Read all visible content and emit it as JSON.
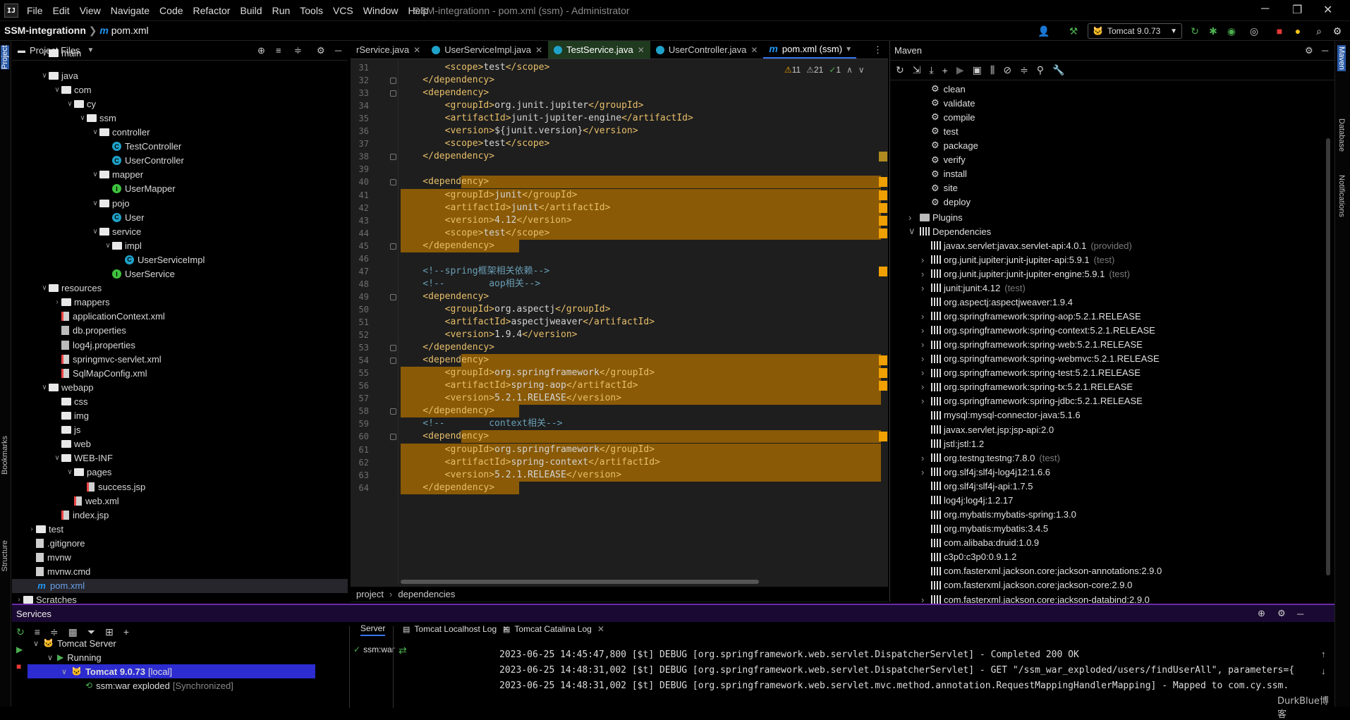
{
  "title_bar": {
    "logo": "IJ",
    "menus": [
      "File",
      "Edit",
      "View",
      "Navigate",
      "Code",
      "Refactor",
      "Build",
      "Run",
      "Tools",
      "VCS",
      "Window",
      "Help"
    ],
    "title": "SSM-integrationn - pom.xml (ssm) - Administrator"
  },
  "nav": {
    "project": "SSM-integrationn",
    "file": "pom.xml",
    "run_config": "Tomcat 9.0.73"
  },
  "left_strip": {
    "project": "Project",
    "bookmarks": "Bookmarks",
    "structure": "Structure"
  },
  "project_panel": {
    "title": "Project Files",
    "tree": [
      {
        "label": "main",
        "kind": "folder"
      },
      {
        "label": "java",
        "kind": "folder"
      },
      {
        "label": "com",
        "kind": "folder"
      },
      {
        "label": "cy",
        "kind": "folder"
      },
      {
        "label": "ssm",
        "kind": "folder"
      },
      {
        "label": "controller",
        "kind": "folder"
      },
      {
        "label": "TestController",
        "kind": "class"
      },
      {
        "label": "UserController",
        "kind": "class"
      },
      {
        "label": "mapper",
        "kind": "folder"
      },
      {
        "label": "UserMapper",
        "kind": "interface"
      },
      {
        "label": "pojo",
        "kind": "folder"
      },
      {
        "label": "User",
        "kind": "class"
      },
      {
        "label": "service",
        "kind": "folder"
      },
      {
        "label": "impl",
        "kind": "folder"
      },
      {
        "label": "UserServiceImpl",
        "kind": "class"
      },
      {
        "label": "UserService",
        "kind": "interface"
      },
      {
        "label": "resources",
        "kind": "folder"
      },
      {
        "label": "mappers",
        "kind": "folder"
      },
      {
        "label": "applicationContext.xml",
        "kind": "xml"
      },
      {
        "label": "db.properties",
        "kind": "prop"
      },
      {
        "label": "log4j.properties",
        "kind": "prop"
      },
      {
        "label": "springmvc-servlet.xml",
        "kind": "xml"
      },
      {
        "label": "SqlMapConfig.xml",
        "kind": "xml"
      },
      {
        "label": "webapp",
        "kind": "folder"
      },
      {
        "label": "css",
        "kind": "folder"
      },
      {
        "label": "img",
        "kind": "folder"
      },
      {
        "label": "js",
        "kind": "folder"
      },
      {
        "label": "web",
        "kind": "folder"
      },
      {
        "label": "WEB-INF",
        "kind": "folder"
      },
      {
        "label": "pages",
        "kind": "folder"
      },
      {
        "label": "success.jsp",
        "kind": "jsp"
      },
      {
        "label": "web.xml",
        "kind": "xml"
      },
      {
        "label": "index.jsp",
        "kind": "jsp"
      },
      {
        "label": "test",
        "kind": "folder"
      },
      {
        "label": ".gitignore",
        "kind": "file"
      },
      {
        "label": "mvnw",
        "kind": "file"
      },
      {
        "label": "mvnw.cmd",
        "kind": "file"
      },
      {
        "label": "pom.xml",
        "kind": "pom"
      },
      {
        "label": "Scratches",
        "kind": "folder"
      }
    ]
  },
  "editor": {
    "tabs": [
      {
        "label": "rService.java",
        "kind": "class"
      },
      {
        "label": "UserServiceImpl.java",
        "kind": "class"
      },
      {
        "label": "TestService.java",
        "kind": "class"
      },
      {
        "label": "UserController.java",
        "kind": "class"
      },
      {
        "label": "pom.xml (ssm)",
        "kind": "pom"
      }
    ],
    "inspections": {
      "warnings": "11",
      "weak": "21",
      "ok": "1"
    },
    "lines": [
      {
        "n": "31",
        "text": "        <scope>test</scope>"
      },
      {
        "n": "32",
        "text": "    </dependency>"
      },
      {
        "n": "33",
        "text": "    <dependency>"
      },
      {
        "n": "34",
        "text": "        <groupId>org.junit.jupiter</groupId>"
      },
      {
        "n": "35",
        "text": "        <artifactId>junit-jupiter-engine</artifactId>"
      },
      {
        "n": "36",
        "text": "        <version>${junit.version}</version>"
      },
      {
        "n": "37",
        "text": "        <scope>test</scope>"
      },
      {
        "n": "38",
        "text": "    </dependency>"
      },
      {
        "n": "39",
        "text": ""
      },
      {
        "n": "40",
        "text": "    <dependency>"
      },
      {
        "n": "41",
        "text": "        <groupId>junit</groupId>"
      },
      {
        "n": "42",
        "text": "        <artifactId>junit</artifactId>"
      },
      {
        "n": "43",
        "text": "        <version>4.12</version>"
      },
      {
        "n": "44",
        "text": "        <scope>test</scope>"
      },
      {
        "n": "45",
        "text": "    </dependency>"
      },
      {
        "n": "46",
        "text": ""
      },
      {
        "n": "47",
        "text": "    <!--spring框架相关依赖-->"
      },
      {
        "n": "48",
        "text": "    <!--        aop相关-->"
      },
      {
        "n": "49",
        "text": "    <dependency>"
      },
      {
        "n": "50",
        "text": "        <groupId>org.aspectj</groupId>"
      },
      {
        "n": "51",
        "text": "        <artifactId>aspectjweaver</artifactId>"
      },
      {
        "n": "52",
        "text": "        <version>1.9.4</version>"
      },
      {
        "n": "53",
        "text": "    </dependency>"
      },
      {
        "n": "54",
        "text": "    <dependency>"
      },
      {
        "n": "55",
        "text": "        <groupId>org.springframework</groupId>"
      },
      {
        "n": "56",
        "text": "        <artifactId>spring-aop</artifactId>"
      },
      {
        "n": "57",
        "text": "        <version>5.2.1.RELEASE</version>"
      },
      {
        "n": "58",
        "text": "    </dependency>"
      },
      {
        "n": "59",
        "text": "    <!--        context相关-->"
      },
      {
        "n": "60",
        "text": "    <dependency>"
      },
      {
        "n": "61",
        "text": "        <groupId>org.springframework</groupId>"
      },
      {
        "n": "62",
        "text": "        <artifactId>spring-context</artifactId>"
      },
      {
        "n": "63",
        "text": "        <version>5.2.1.RELEASE</version>"
      },
      {
        "n": "64",
        "text": "    </dependency>"
      }
    ],
    "breadcrumb": [
      "project",
      "dependencies"
    ]
  },
  "maven": {
    "title": "Maven",
    "lifecycle": [
      "clean",
      "validate",
      "compile",
      "test",
      "package",
      "verify",
      "install",
      "site",
      "deploy"
    ],
    "plugins": "Plugins",
    "dependencies_label": "Dependencies",
    "deps": [
      {
        "name": "javax.servlet:javax.servlet-api:4.0.1",
        "scope": "(provided)"
      },
      {
        "name": "org.junit.jupiter:junit-jupiter-api:5.9.1",
        "scope": "(test)"
      },
      {
        "name": "org.junit.jupiter:junit-jupiter-engine:5.9.1",
        "scope": "(test)"
      },
      {
        "name": "junit:junit:4.12",
        "scope": "(test)"
      },
      {
        "name": "org.aspectj:aspectjweaver:1.9.4",
        "scope": ""
      },
      {
        "name": "org.springframework:spring-aop:5.2.1.RELEASE",
        "scope": ""
      },
      {
        "name": "org.springframework:spring-context:5.2.1.RELEASE",
        "scope": ""
      },
      {
        "name": "org.springframework:spring-web:5.2.1.RELEASE",
        "scope": ""
      },
      {
        "name": "org.springframework:spring-webmvc:5.2.1.RELEASE",
        "scope": ""
      },
      {
        "name": "org.springframework:spring-test:5.2.1.RELEASE",
        "scope": ""
      },
      {
        "name": "org.springframework:spring-tx:5.2.1.RELEASE",
        "scope": ""
      },
      {
        "name": "org.springframework:spring-jdbc:5.2.1.RELEASE",
        "scope": ""
      },
      {
        "name": "mysql:mysql-connector-java:5.1.6",
        "scope": ""
      },
      {
        "name": "javax.servlet.jsp:jsp-api:2.0",
        "scope": ""
      },
      {
        "name": "jstl:jstl:1.2",
        "scope": ""
      },
      {
        "name": "org.testng:testng:7.8.0",
        "scope": "(test)"
      },
      {
        "name": "org.slf4j:slf4j-log4j12:1.6.6",
        "scope": ""
      },
      {
        "name": "org.slf4j:slf4j-api:1.7.5",
        "scope": ""
      },
      {
        "name": "log4j:log4j:1.2.17",
        "scope": ""
      },
      {
        "name": "org.mybatis:mybatis-spring:1.3.0",
        "scope": ""
      },
      {
        "name": "org.mybatis:mybatis:3.4.5",
        "scope": ""
      },
      {
        "name": "com.alibaba:druid:1.0.9",
        "scope": ""
      },
      {
        "name": "c3p0:c3p0:0.9.1.2",
        "scope": ""
      },
      {
        "name": "com.fasterxml.jackson.core:jackson-annotations:2.9.0",
        "scope": ""
      },
      {
        "name": "com.fasterxml.jackson.core:jackson-core:2.9.0",
        "scope": ""
      },
      {
        "name": "com.fasterxml.jackson.core:jackson-databind:2.9.0",
        "scope": ""
      }
    ]
  },
  "right_strip": {
    "maven": "Maven",
    "database": "Database",
    "notifications": "Notifications"
  },
  "services": {
    "title": "Services",
    "tree": [
      "Tomcat Server",
      "Running",
      "Tomcat 9.0.73",
      "ssm:war exploded"
    ],
    "tomcat_suffix": "[local]",
    "artifact_state": "[Synchronized]",
    "tabs": [
      "Server",
      "Tomcat Localhost Log",
      "Tomcat Catalina Log"
    ],
    "deploy_item": "ssm:war",
    "log": [
      "2023-06-25 14:45:47,800 [$t] DEBUG [org.springframework.web.servlet.DispatcherServlet] - Completed 200 OK",
      "2023-06-25 14:48:31,002 [$t] DEBUG [org.springframework.web.servlet.DispatcherServlet] - GET \"/ssm_war_exploded/users/findUserAll\", parameters={",
      "2023-06-25 14:48:31,002 [$t] DEBUG [org.springframework.web.servlet.mvc.method.annotation.RequestMappingHandlerMapping] - Mapped to com.cy.ssm."
    ],
    "watermark": "DurkBlue博客"
  },
  "colors": {
    "highlight": "#8a5a06",
    "accent": "#3574f0",
    "services_border": "#6a2aa8"
  }
}
